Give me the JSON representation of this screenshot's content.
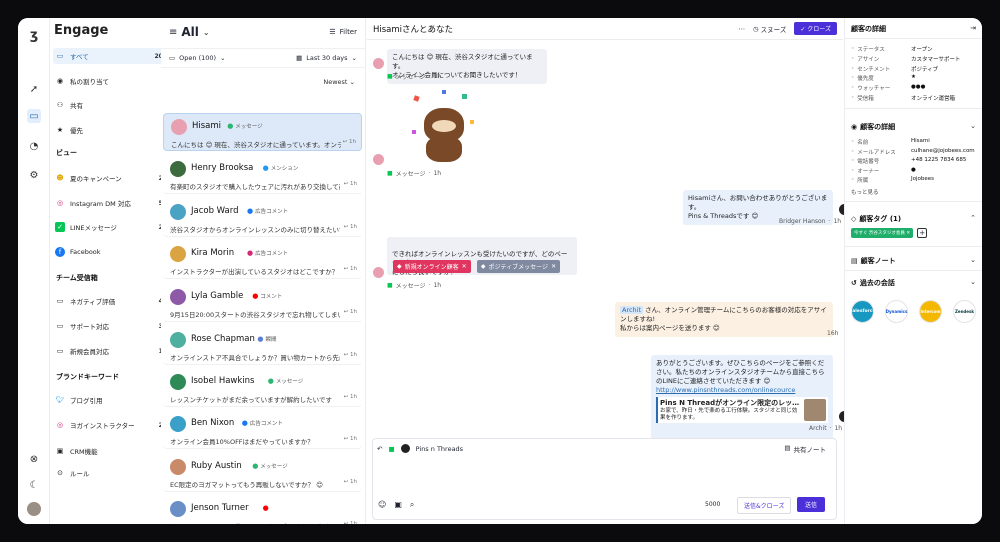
{
  "nav": {
    "brand": "Engage",
    "items": [
      {
        "label": "すべて",
        "count": "200"
      },
      {
        "label": "私の割り当て",
        "count": "5"
      },
      {
        "label": "共有",
        "count": "7"
      },
      {
        "label": "優先",
        "count": "9"
      }
    ],
    "views_title": "ビュー",
    "views": [
      {
        "label": "夏のキャンペーン",
        "count": "28"
      },
      {
        "label": "Instagram DM 対応",
        "count": "56"
      },
      {
        "label": "LINEメッセージ",
        "count": "23"
      },
      {
        "label": "Facebook",
        "count": "2"
      }
    ],
    "team_title": "チーム受信箱",
    "team": [
      {
        "label": "ネガティブ評価",
        "count": "41"
      },
      {
        "label": "サポート対応",
        "count": "32"
      },
      {
        "label": "新規会員対応",
        "count": "12"
      }
    ],
    "brand_kw_title": "ブランドキーワード",
    "brand_kw": [
      {
        "label": "ブログ引用",
        "count": "7"
      },
      {
        "label": "ヨガインストラクター",
        "count": "22"
      }
    ],
    "bottom": [
      {
        "label": "CRM機能"
      },
      {
        "label": "ルール"
      }
    ]
  },
  "list": {
    "title": "All",
    "filter": "Filter",
    "status": "Open (100)",
    "range": "Last 30 days",
    "sort": "Newest",
    "conversations": [
      {
        "name": "Hisami",
        "tag": "メッセージ",
        "preview": "こんにちは 😊 現在、渋谷スタジオに通っています。オンライン会員…",
        "time": "1h",
        "color": "#e8a0b0",
        "tag_color": "#2bb673"
      },
      {
        "name": "Henry Brooksa",
        "tag": "メンション",
        "preview": "有楽町のスタジオで購入したウェアに汚れがあり交換して欲…",
        "time": "1h",
        "color": "#3c6b3e",
        "tag_color": "#1d9bf0"
      },
      {
        "name": "Jacob Ward",
        "tag": "広告コメント",
        "preview": "渋谷スタジオからオンラインレッスンのみに切り替えたいで…",
        "time": "1h",
        "color": "#4aa3c2",
        "tag_color": "#1877f2"
      },
      {
        "name": "Kira Morin",
        "tag": "広告コメント",
        "preview": "インストラクターが出演しているスタジオはどこですか？",
        "time": "1h",
        "color": "#d9a441",
        "tag_color": "#d62976"
      },
      {
        "name": "Lyla Gamble",
        "tag": "コメント",
        "preview": "9月15日20:00スタートの渋谷スタジオで忘れ物してしまいま…",
        "time": "1h",
        "color": "#8e5aa8",
        "tag_color": "#ff0000"
      },
      {
        "name": "Rose Chapman",
        "tag": "瞬間",
        "preview": "オンラインストア不具合でしょうか？買い物カートから先に進…",
        "time": "1h",
        "color": "#4fb0a0",
        "tag_color": "#5a7fd6"
      },
      {
        "name": "Isobel Hawkins",
        "tag": "メッセージ",
        "preview": "レッスンチケットがまだ余っていますが解約したいです",
        "time": "1h",
        "color": "#2e8b57",
        "tag_color": "#2bb673"
      },
      {
        "name": "Ben Nixon",
        "tag": "広告コメント",
        "preview": "オンライン会員10%OFFはまだやっていますか？",
        "time": "1h",
        "color": "#3aa0c8",
        "tag_color": "#1877f2"
      },
      {
        "name": "Ruby Austin",
        "tag": "メッセージ",
        "preview": "EC限定のヨガマットってもう再販しないですか？ 😊",
        "time": "1h",
        "color": "#c98a6a",
        "tag_color": "#2bb673"
      },
      {
        "name": "Jenson Turner",
        "tag": "",
        "preview": "オンラインレッスンの動画のアーカイブはどこから観れます…",
        "time": "1h",
        "color": "#6a8fc7",
        "tag_color": "#ff0000"
      }
    ]
  },
  "chat": {
    "title": "Hisamiさんとあなた",
    "snooze": "スヌーズ",
    "close": "クローズ",
    "msg1": "こんにちは 😊 現在、渋谷スタジオに通っています。\nオンライン会員についてお聞きしたいです！",
    "meta1_source": "メッセージ",
    "meta1_time": "1h",
    "meta2_source": "メッセージ",
    "meta2_time": "1h",
    "reply1": "Hisamiさん、お問い合わせありがとうございます。\nPins & Threadsです 😊",
    "reply1_meta": "Bridger Hanson",
    "reply1_time": "1h",
    "msg3": "できればオンラインレッスンも受けたいのですが、どのページを参照\nにしたら良いですか？",
    "tag_a": "新規オンライン顧客",
    "tag_b": "ポジティブメッセージ",
    "meta3_source": "メッセージ",
    "meta3_time": "1h",
    "note_mention": "Archit",
    "note_text": " さん、オンライン管理チームにこちらのお客様の対応をアサインしますね!\n私からは案内ページを送ります 😊",
    "note_time": "16h",
    "reply2": "ありがとうございます。ぜひこちらのページをご参照ください。私たちのオンラインスタジオチームから直接こちらのLINEにご連絡させていただきます 😊",
    "reply2_link": "http://www.pinsnthreads.com/onlinecource",
    "reply2_card_title": "Pins N Threadがオンライン限定のレッ…",
    "reply2_card_desc": "お家で、昨日・先で楽める工行体験。スタジオと同じ効果を作ります。",
    "reply2_meta": "Archit",
    "reply2_time": "1h",
    "composer_account": "Pins n Threads",
    "composer_shared": "共有ノート",
    "composer_count": "5000",
    "composer_send_close": "送信&クローズ",
    "composer_send": "送信"
  },
  "details": {
    "title": "顧客の詳細",
    "status_rows": [
      {
        "k": "ステータス",
        "v": "オープン"
      },
      {
        "k": "アサイン",
        "v": "カスタマーサポート"
      },
      {
        "k": "センチメント",
        "v": "ポジティブ"
      },
      {
        "k": "優先度",
        "v": "★"
      },
      {
        "k": "ウォッチャー",
        "v": "●●●"
      },
      {
        "k": "受信箱",
        "v": "オンライン運営箱"
      }
    ],
    "customer_title": "顧客の詳細",
    "customer_rows": [
      {
        "k": "名前",
        "v": "Hisami"
      },
      {
        "k": "メールアドレス",
        "v": "culhane@jojobees.com"
      },
      {
        "k": "電話番号",
        "v": "+48 1225 7834 685"
      },
      {
        "k": "オーナー",
        "v": "●"
      },
      {
        "k": "所属",
        "v": "Jojobees"
      }
    ],
    "more": "もっと見る",
    "tags_title": "顧客タグ (1)",
    "tag": "今すぐ 渋谷スタジオ会員",
    "notes_title": "顧客ノート",
    "history_title": "過去の会話",
    "history_logos": [
      "salesforce",
      "Dynamics",
      "Intercom",
      "Zendesk"
    ]
  },
  "colors": {
    "accent": "#4b2fd8",
    "active_bg": "#dde9f8",
    "line": "#06c755"
  }
}
